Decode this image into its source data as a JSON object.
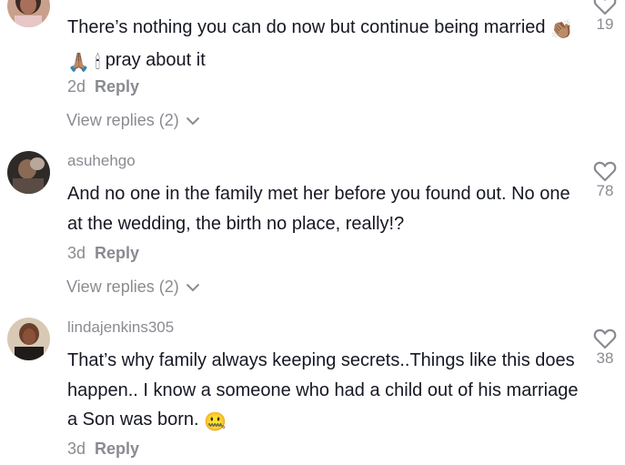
{
  "comments": [
    {
      "username": "",
      "text_before_emoji": "There’s nothing you can do now but continue being married",
      "emoji_clap": "👏🏽",
      "emoji_pray": "🙏🏽",
      "emoji_candle": "🕯",
      "text_after_emoji": "pray about it",
      "time": "2d",
      "reply_label": "Reply",
      "likes": "19",
      "view_replies": "View replies (2)"
    },
    {
      "username": "asuhehgo",
      "text": "And no one in the family met her before you found out. No one at the wedding, the birth no place, really!?",
      "time": "3d",
      "reply_label": "Reply",
      "likes": "78",
      "view_replies": "View replies (2)"
    },
    {
      "username": "lindajenkins305",
      "text": "That’s why family always keeping secrets..Things like this does happen.. I know a someone who had a child out of his marriage a Son was born.",
      "emoji_zipper": "🤐",
      "time": "3d",
      "reply_label": "Reply",
      "likes": "38"
    }
  ],
  "colors": {
    "text": "#161823",
    "muted": "#8a8b91",
    "background": "#ffffff"
  },
  "icons": {
    "like": "heart-outline-icon",
    "expand": "chevron-down-icon"
  }
}
